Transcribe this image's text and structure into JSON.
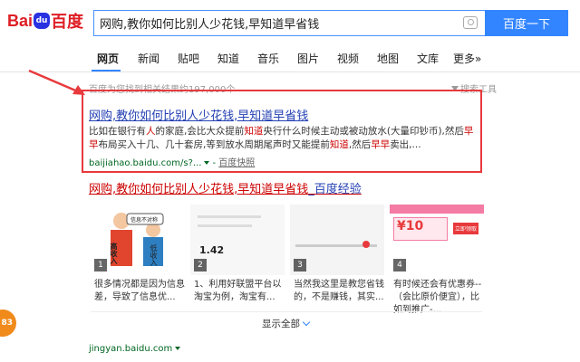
{
  "logo": {
    "text_left": "Bai",
    "paw": "du",
    "text_right": "百度"
  },
  "search": {
    "query": "网购,教你如何比别人少花钱,早知道早省钱",
    "button_label": "百度一下"
  },
  "tabs": [
    {
      "label": "网页",
      "active": true
    },
    {
      "label": "新闻"
    },
    {
      "label": "贴吧"
    },
    {
      "label": "知道"
    },
    {
      "label": "音乐"
    },
    {
      "label": "图片"
    },
    {
      "label": "视频"
    },
    {
      "label": "地图"
    },
    {
      "label": "文库"
    },
    {
      "label": "更多»"
    }
  ],
  "stats": {
    "text": "百度为您找到相关结果约197,000个",
    "tools_label": "搜索工具"
  },
  "result1": {
    "title": "网购,教你如何比别人少花钱,早知道早省钱",
    "snippet_parts": [
      {
        "t": "比如在银行有"
      },
      {
        "t": "人",
        "red": true
      },
      {
        "t": "的家庭,会比大众提前"
      },
      {
        "t": "知道",
        "red": true
      },
      {
        "t": "央行什么时候主动或被动放水(大量印钞币),然后"
      },
      {
        "t": "早早",
        "red": true
      },
      {
        "t": "布局买入十几、几十套房,等到放水周期尾声时又能提前"
      },
      {
        "t": "知道",
        "red": true
      },
      {
        "t": ",然后"
      },
      {
        "t": "早早",
        "red": true
      },
      {
        "t": "卖出,..."
      }
    ],
    "url": "baijiahao.baidu.com/s?...",
    "snapshot": "百度快照"
  },
  "result2": {
    "title_red": "网购,教你如何比别人少花钱,早知道早省钱",
    "title_suffix": "_百度经验"
  },
  "thumbs": [
    {
      "num": "1",
      "caption": "很多情况都是因为信息差，导致了信息优..."
    },
    {
      "num": "2",
      "caption": "1、利用好联盟平台以淘宝为例，淘宝有..."
    },
    {
      "num": "3",
      "caption": "当然我这里是教您省钱的，不是赚钱，其实..."
    },
    {
      "num": "4",
      "caption": "有时候还会有优惠券--（会比原价便宜），比如到推广-..."
    }
  ],
  "thumb_text": {
    "t1a": "高收入",
    "t1b": "低收入",
    "t1c": "信息不对称",
    "t2a": "1.42",
    "t4a": "¥10",
    "t4b": "立即领取"
  },
  "show_all": "显示全部",
  "result3": {
    "url": "jingyan.baidu.com"
  },
  "badge": "83",
  "colors": {
    "accent": "#3385ff",
    "link": "#2440b3",
    "highlight_border": "#e8393c",
    "url_green": "#006621"
  }
}
